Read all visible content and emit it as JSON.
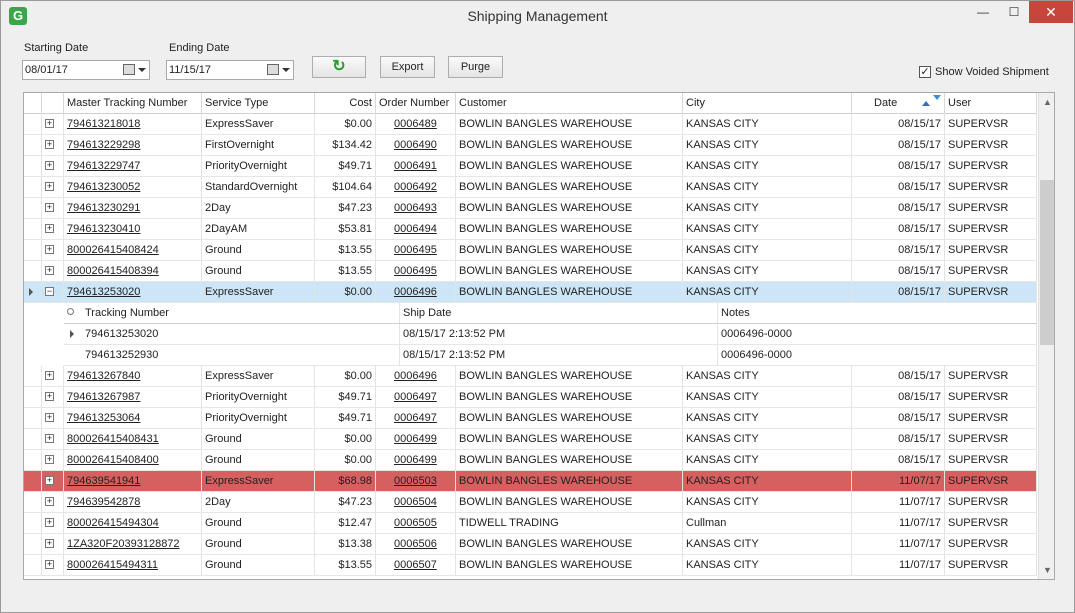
{
  "window": {
    "title": "Shipping Management",
    "app_icon": "G"
  },
  "filters": {
    "start_label": "Starting Date",
    "start_value": "08/01/17",
    "end_label": "Ending Date",
    "end_value": "11/15/17",
    "export_label": "Export",
    "purge_label": "Purge",
    "show_voided_label": "Show Voided Shipment",
    "show_voided_checked": true
  },
  "grid": {
    "columns": [
      "Master Tracking Number",
      "Service Type",
      "Cost",
      "Order Number",
      "Customer",
      "City",
      "Date",
      "User"
    ],
    "rows_before": [
      [
        "794613218018",
        "ExpressSaver",
        "$0.00",
        "0006489",
        "BOWLIN BANGLES WAREHOUSE",
        "KANSAS CITY",
        "08/15/17",
        "SUPERVSR"
      ],
      [
        "794613229298",
        "FirstOvernight",
        "$134.42",
        "0006490",
        "BOWLIN BANGLES WAREHOUSE",
        "KANSAS CITY",
        "08/15/17",
        "SUPERVSR"
      ],
      [
        "794613229747",
        "PriorityOvernight",
        "$49.71",
        "0006491",
        "BOWLIN BANGLES WAREHOUSE",
        "KANSAS CITY",
        "08/15/17",
        "SUPERVSR"
      ],
      [
        "794613230052",
        "StandardOvernight",
        "$104.64",
        "0006492",
        "BOWLIN BANGLES WAREHOUSE",
        "KANSAS CITY",
        "08/15/17",
        "SUPERVSR"
      ],
      [
        "794613230291",
        "2Day",
        "$47.23",
        "0006493",
        "BOWLIN BANGLES WAREHOUSE",
        "KANSAS CITY",
        "08/15/17",
        "SUPERVSR"
      ],
      [
        "794613230410",
        "2DayAM",
        "$53.81",
        "0006494",
        "BOWLIN BANGLES WAREHOUSE",
        "KANSAS CITY",
        "08/15/17",
        "SUPERVSR"
      ],
      [
        "800026415408424",
        "Ground",
        "$13.55",
        "0006495",
        "BOWLIN BANGLES WAREHOUSE",
        "KANSAS CITY",
        "08/15/17",
        "SUPERVSR"
      ],
      [
        "800026415408394",
        "Ground",
        "$13.55",
        "0006495",
        "BOWLIN BANGLES WAREHOUSE",
        "KANSAS CITY",
        "08/15/17",
        "SUPERVSR"
      ]
    ],
    "selected_row": [
      "794613253020",
      "ExpressSaver",
      "$0.00",
      "0006496",
      "BOWLIN BANGLES WAREHOUSE",
      "KANSAS CITY",
      "08/15/17",
      "SUPERVSR"
    ],
    "detail": {
      "columns": [
        "Tracking Number",
        "Ship Date",
        "Notes"
      ],
      "rows": [
        [
          "794613253020",
          "08/15/17 2:13:52 PM",
          "0006496-0000"
        ],
        [
          "794613252930",
          "08/15/17 2:13:52 PM",
          "0006496-0000"
        ]
      ]
    },
    "rows_after": [
      [
        "794613267840",
        "ExpressSaver",
        "$0.00",
        "0006496",
        "BOWLIN BANGLES WAREHOUSE",
        "KANSAS CITY",
        "08/15/17",
        "SUPERVSR"
      ],
      [
        "794613267987",
        "PriorityOvernight",
        "$49.71",
        "0006497",
        "BOWLIN BANGLES WAREHOUSE",
        "KANSAS CITY",
        "08/15/17",
        "SUPERVSR"
      ],
      [
        "794613253064",
        "PriorityOvernight",
        "$49.71",
        "0006497",
        "BOWLIN BANGLES WAREHOUSE",
        "KANSAS CITY",
        "08/15/17",
        "SUPERVSR"
      ],
      [
        "800026415408431",
        "Ground",
        "$0.00",
        "0006499",
        "BOWLIN BANGLES WAREHOUSE",
        "KANSAS CITY",
        "08/15/17",
        "SUPERVSR"
      ],
      [
        "800026415408400",
        "Ground",
        "$0.00",
        "0006499",
        "BOWLIN BANGLES WAREHOUSE",
        "KANSAS CITY",
        "08/15/17",
        "SUPERVSR"
      ]
    ],
    "voided_row": [
      "794639541941",
      "ExpressSaver",
      "$68.98",
      "0006503",
      "BOWLIN BANGLES WAREHOUSE",
      "KANSAS CITY",
      "11/07/17",
      "SUPERVSR"
    ],
    "rows_end": [
      [
        "794639542878",
        "2Day",
        "$47.23",
        "0006504",
        "BOWLIN BANGLES WAREHOUSE",
        "KANSAS CITY",
        "11/07/17",
        "SUPERVSR"
      ],
      [
        "800026415494304",
        "Ground",
        "$12.47",
        "0006505",
        "TIDWELL TRADING",
        "Cullman",
        "11/07/17",
        "SUPERVSR"
      ],
      [
        "1ZA320F20393128872",
        "Ground",
        "$13.38",
        "0006506",
        "BOWLIN BANGLES WAREHOUSE",
        "KANSAS CITY",
        "11/07/17",
        "SUPERVSR"
      ],
      [
        "800026415494311",
        "Ground",
        "$13.55",
        "0006507",
        "BOWLIN BANGLES WAREHOUSE",
        "KANSAS CITY",
        "11/07/17",
        "SUPERVSR"
      ]
    ]
  },
  "colors": {
    "selected": "#cde6f7",
    "voided": "#d65f5f",
    "refresh": "#2a9d2f"
  }
}
